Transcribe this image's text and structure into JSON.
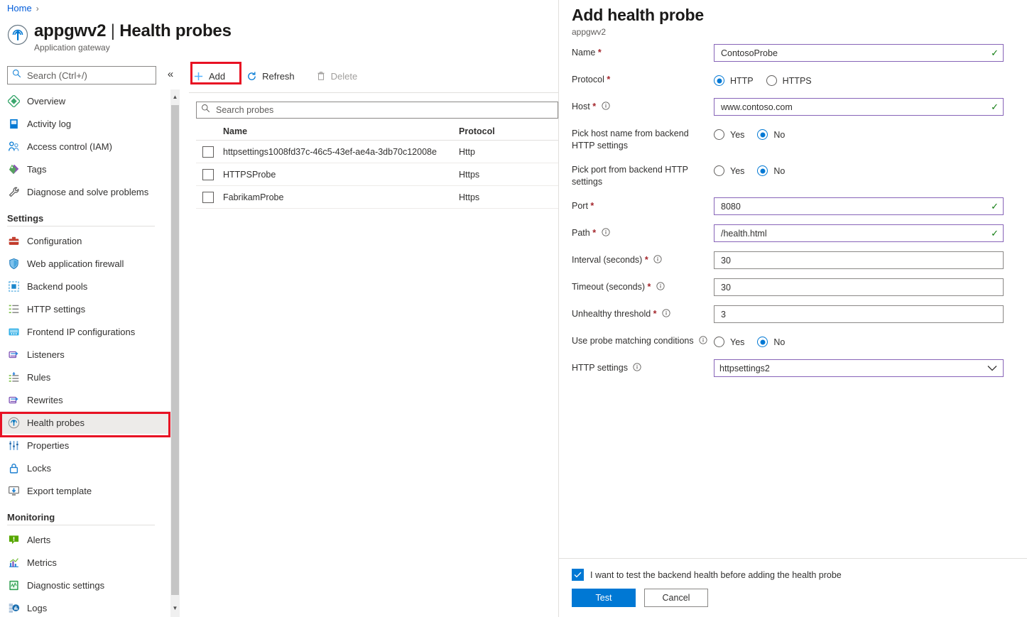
{
  "breadcrumb": {
    "home": "Home",
    "separator": "›"
  },
  "resource": {
    "name": "appgwv2",
    "separator": "|",
    "page": "Health probes",
    "type": "Application gateway",
    "icon": "application-gateway-icon"
  },
  "sidebar": {
    "search_placeholder": "Search (Ctrl+/)",
    "search_value": "",
    "collapse_glyph": "«",
    "items": [
      {
        "label": "Overview",
        "icon": "overview-icon",
        "selected": false
      },
      {
        "label": "Activity log",
        "icon": "activity-log-icon",
        "selected": false
      },
      {
        "label": "Access control (IAM)",
        "icon": "access-control-icon",
        "selected": false
      },
      {
        "label": "Tags",
        "icon": "tags-icon",
        "selected": false
      },
      {
        "label": "Diagnose and solve problems",
        "icon": "diagnose-icon",
        "selected": false
      }
    ],
    "groups": [
      {
        "title": "Settings",
        "items": [
          {
            "label": "Configuration",
            "icon": "configuration-icon",
            "selected": false
          },
          {
            "label": "Web application firewall",
            "icon": "firewall-shield-icon",
            "selected": false
          },
          {
            "label": "Backend pools",
            "icon": "backend-pools-icon",
            "selected": false
          },
          {
            "label": "HTTP settings",
            "icon": "http-settings-icon",
            "selected": false
          },
          {
            "label": "Frontend IP configurations",
            "icon": "frontend-ip-icon",
            "selected": false
          },
          {
            "label": "Listeners",
            "icon": "listeners-icon",
            "selected": false
          },
          {
            "label": "Rules",
            "icon": "rules-icon",
            "selected": false
          },
          {
            "label": "Rewrites",
            "icon": "rewrites-icon",
            "selected": false
          },
          {
            "label": "Health probes",
            "icon": "health-probe-icon",
            "selected": true
          },
          {
            "label": "Properties",
            "icon": "properties-icon",
            "selected": false
          },
          {
            "label": "Locks",
            "icon": "lock-icon",
            "selected": false
          },
          {
            "label": "Export template",
            "icon": "export-template-icon",
            "selected": false
          }
        ]
      },
      {
        "title": "Monitoring",
        "items": [
          {
            "label": "Alerts",
            "icon": "alerts-icon",
            "selected": false
          },
          {
            "label": "Metrics",
            "icon": "metrics-icon",
            "selected": false
          },
          {
            "label": "Diagnostic settings",
            "icon": "diagnostic-settings-icon",
            "selected": false
          },
          {
            "label": "Logs",
            "icon": "logs-icon",
            "selected": false
          }
        ]
      }
    ]
  },
  "command_bar": {
    "add": {
      "label": "Add",
      "icon": "plus-icon",
      "disabled": false,
      "highlighted": true
    },
    "refresh": {
      "label": "Refresh",
      "icon": "refresh-icon",
      "disabled": false
    },
    "delete": {
      "label": "Delete",
      "icon": "trash-icon",
      "disabled": true
    }
  },
  "probe_list": {
    "filter_placeholder": "Search probes",
    "filter_value": "",
    "columns": [
      "Name",
      "Protocol"
    ],
    "rows": [
      {
        "name": "httpsettings1008fd37c-46c5-43ef-ae4a-3db70c12008e",
        "protocol": "Http",
        "checked": false
      },
      {
        "name": "HTTPSProbe",
        "protocol": "Https",
        "checked": false
      },
      {
        "name": "FabrikamProbe",
        "protocol": "Https",
        "checked": false
      }
    ]
  },
  "panel": {
    "title": "Add health probe",
    "subtitle": "appgwv2",
    "fields": {
      "name": {
        "label": "Name",
        "required": true,
        "value": "ContosoProbe",
        "valid": true
      },
      "protocol": {
        "label": "Protocol",
        "required": true,
        "options": [
          "HTTP",
          "HTTPS"
        ],
        "selected": "HTTP"
      },
      "host": {
        "label": "Host",
        "required": true,
        "has_info": true,
        "value": "www.contoso.com",
        "valid": true
      },
      "pick_host": {
        "label": "Pick host name from backend HTTP settings",
        "options": [
          "Yes",
          "No"
        ],
        "selected": "No"
      },
      "pick_port": {
        "label": "Pick port from backend HTTP settings",
        "options": [
          "Yes",
          "No"
        ],
        "selected": "No"
      },
      "port": {
        "label": "Port",
        "required": true,
        "value": "8080",
        "valid": true
      },
      "path": {
        "label": "Path",
        "required": true,
        "has_info": true,
        "value": "/health.html",
        "valid": true
      },
      "interval": {
        "label": "Interval (seconds)",
        "required": true,
        "has_info": true,
        "value": "30",
        "valid": false
      },
      "timeout": {
        "label": "Timeout (seconds)",
        "required": true,
        "has_info": true,
        "value": "30",
        "valid": false
      },
      "unhealthy_threshold": {
        "label": "Unhealthy threshold",
        "required": true,
        "has_info": true,
        "value": "3",
        "valid": false
      },
      "probe_matching": {
        "label": "Use probe matching conditions",
        "has_info": true,
        "options": [
          "Yes",
          "No"
        ],
        "selected": "No"
      },
      "http_settings": {
        "label": "HTTP settings",
        "has_info": true,
        "value": "httpsettings2",
        "options": [
          "httpsettings2"
        ]
      }
    },
    "footer": {
      "checkbox_label": "I want to test the backend health before adding the health probe",
      "checkbox_checked": true,
      "primary_button": "Test",
      "secondary_button": "Cancel"
    }
  },
  "colors": {
    "accent": "#0078d4",
    "highlight_box": "#e81123",
    "valid_border": "#8764b8",
    "valid_tick": "#107c10",
    "required_star": "#a4262c",
    "link": "#015cda"
  }
}
